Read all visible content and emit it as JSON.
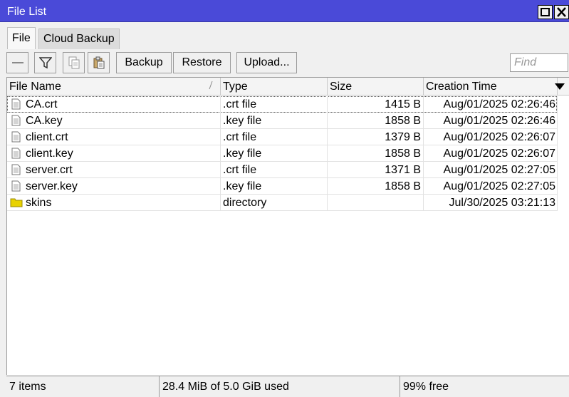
{
  "window": {
    "title": "File List"
  },
  "tabs": [
    {
      "label": "File"
    },
    {
      "label": "Cloud Backup"
    }
  ],
  "toolbar": {
    "backup_label": "Backup",
    "restore_label": "Restore",
    "upload_label": "Upload...",
    "find_placeholder": "Find"
  },
  "table": {
    "columns": [
      "File Name",
      "Type",
      "Size",
      "Creation Time"
    ],
    "rows": [
      {
        "name": "CA.crt",
        "type": ".crt file",
        "size": "1415 B",
        "created": "Aug/01/2025 02:26:46",
        "icon": "file-icon"
      },
      {
        "name": "CA.key",
        "type": ".key file",
        "size": "1858 B",
        "created": "Aug/01/2025 02:26:46",
        "icon": "file-icon"
      },
      {
        "name": "client.crt",
        "type": ".crt file",
        "size": "1379 B",
        "created": "Aug/01/2025 02:26:07",
        "icon": "file-icon"
      },
      {
        "name": "client.key",
        "type": ".key file",
        "size": "1858 B",
        "created": "Aug/01/2025 02:26:07",
        "icon": "file-icon"
      },
      {
        "name": "server.crt",
        "type": ".crt file",
        "size": "1371 B",
        "created": "Aug/01/2025 02:27:05",
        "icon": "file-icon"
      },
      {
        "name": "server.key",
        "type": ".key file",
        "size": "1858 B",
        "created": "Aug/01/2025 02:27:05",
        "icon": "file-icon"
      },
      {
        "name": "skins",
        "type": "directory",
        "size": "",
        "created": "Jul/30/2025 03:21:13",
        "icon": "folder-icon"
      }
    ]
  },
  "status": {
    "count": "7 items",
    "usage": "28.4 MiB of 5.0 GiB used",
    "free": "99% free"
  },
  "colors": {
    "titlebar": "#4a4ad8",
    "folder": "#e8d200"
  }
}
